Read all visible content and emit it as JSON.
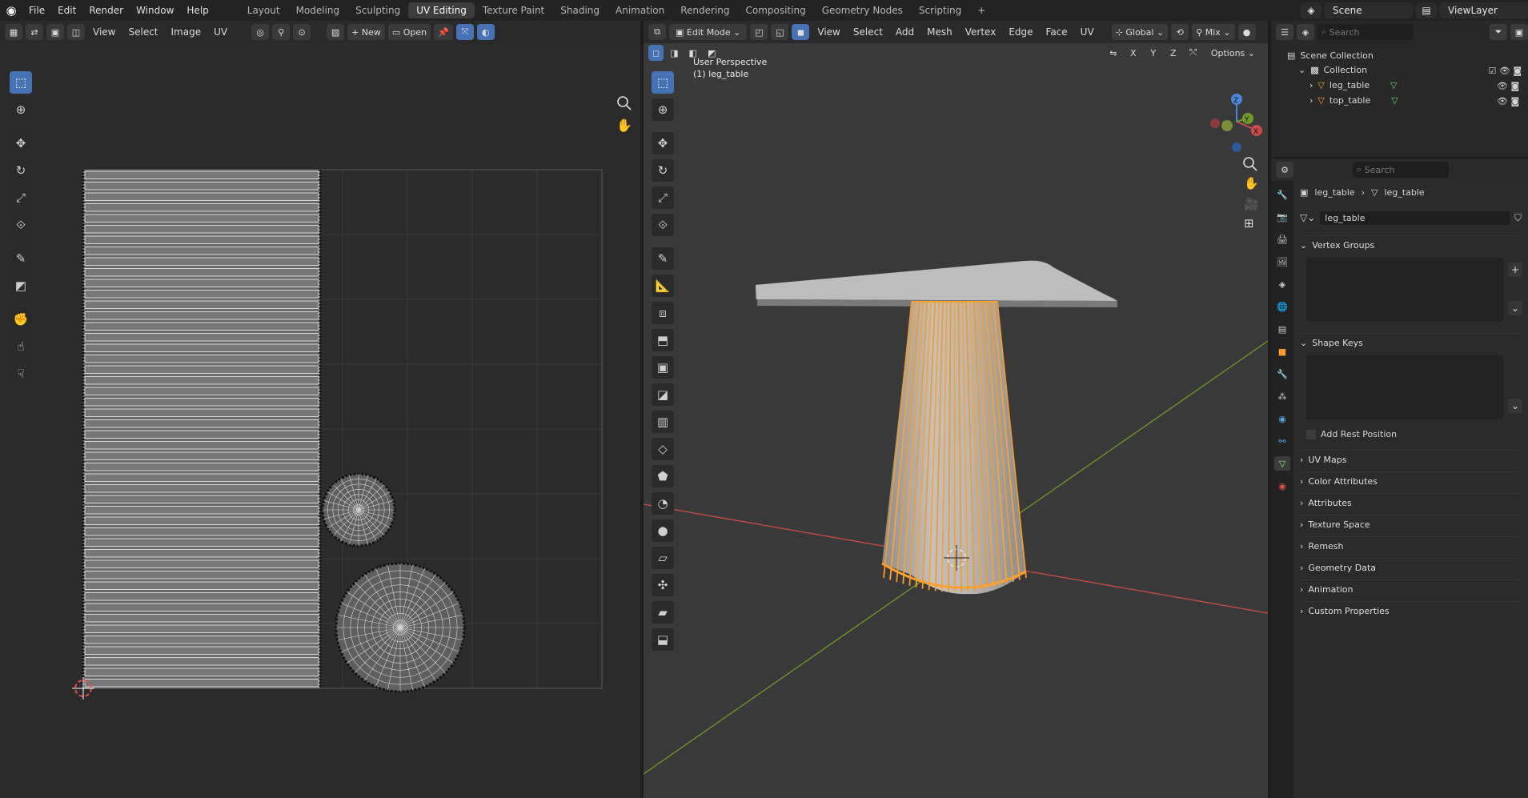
{
  "topbar": {
    "menu": [
      "File",
      "Edit",
      "Render",
      "Window",
      "Help"
    ],
    "workspaces": [
      "Layout",
      "Modeling",
      "Sculpting",
      "UV Editing",
      "Texture Paint",
      "Shading",
      "Animation",
      "Rendering",
      "Compositing",
      "Geometry Nodes",
      "Scripting"
    ],
    "active_workspace": "UV Editing",
    "add_tab": "+",
    "scene": "Scene",
    "view_layer": "ViewLayer"
  },
  "uv_editor": {
    "menus": [
      "View",
      "Select",
      "Image",
      "UV"
    ],
    "new_label": "New",
    "open_label": "Open",
    "icon_names": [
      "select-box-icon",
      "cursor-icon",
      "move-icon",
      "rotate-icon",
      "scale-icon",
      "transform-icon",
      "annotate-icon",
      "rip-icon",
      "grab-icon",
      "relax-icon",
      "pinch-icon"
    ]
  },
  "viewport": {
    "mode": "Edit Mode",
    "menus": [
      "View",
      "Select",
      "Add",
      "Mesh",
      "Vertex",
      "Edge",
      "Face",
      "UV"
    ],
    "orientation": "Global",
    "snap_mix": "Mix",
    "options": "Options",
    "axes": [
      "X",
      "Y",
      "Z"
    ],
    "perspective_text": "User Perspective",
    "object_text": "(1) leg_table",
    "gizmo": {
      "x": "X",
      "y": "Y",
      "z": "Z"
    },
    "colors": {
      "x_axis": "#c94c4c",
      "y_axis": "#6f9a2a",
      "selected": "#ffa12e"
    }
  },
  "outliner": {
    "search_placeholder": "Search",
    "scene_collection": "Scene Collection",
    "collection": "Collection",
    "objects": [
      "leg_table",
      "top_table"
    ]
  },
  "properties": {
    "search_placeholder": "Search",
    "breadcrumb": [
      "leg_table",
      "leg_table"
    ],
    "mesh_name": "leg_table",
    "vertex_groups": "Vertex Groups",
    "shape_keys": "Shape Keys",
    "add_rest_position": "Add Rest Position",
    "sections": [
      "UV Maps",
      "Color Attributes",
      "Attributes",
      "Texture Space",
      "Remesh",
      "Geometry Data",
      "Animation",
      "Custom Properties"
    ]
  }
}
